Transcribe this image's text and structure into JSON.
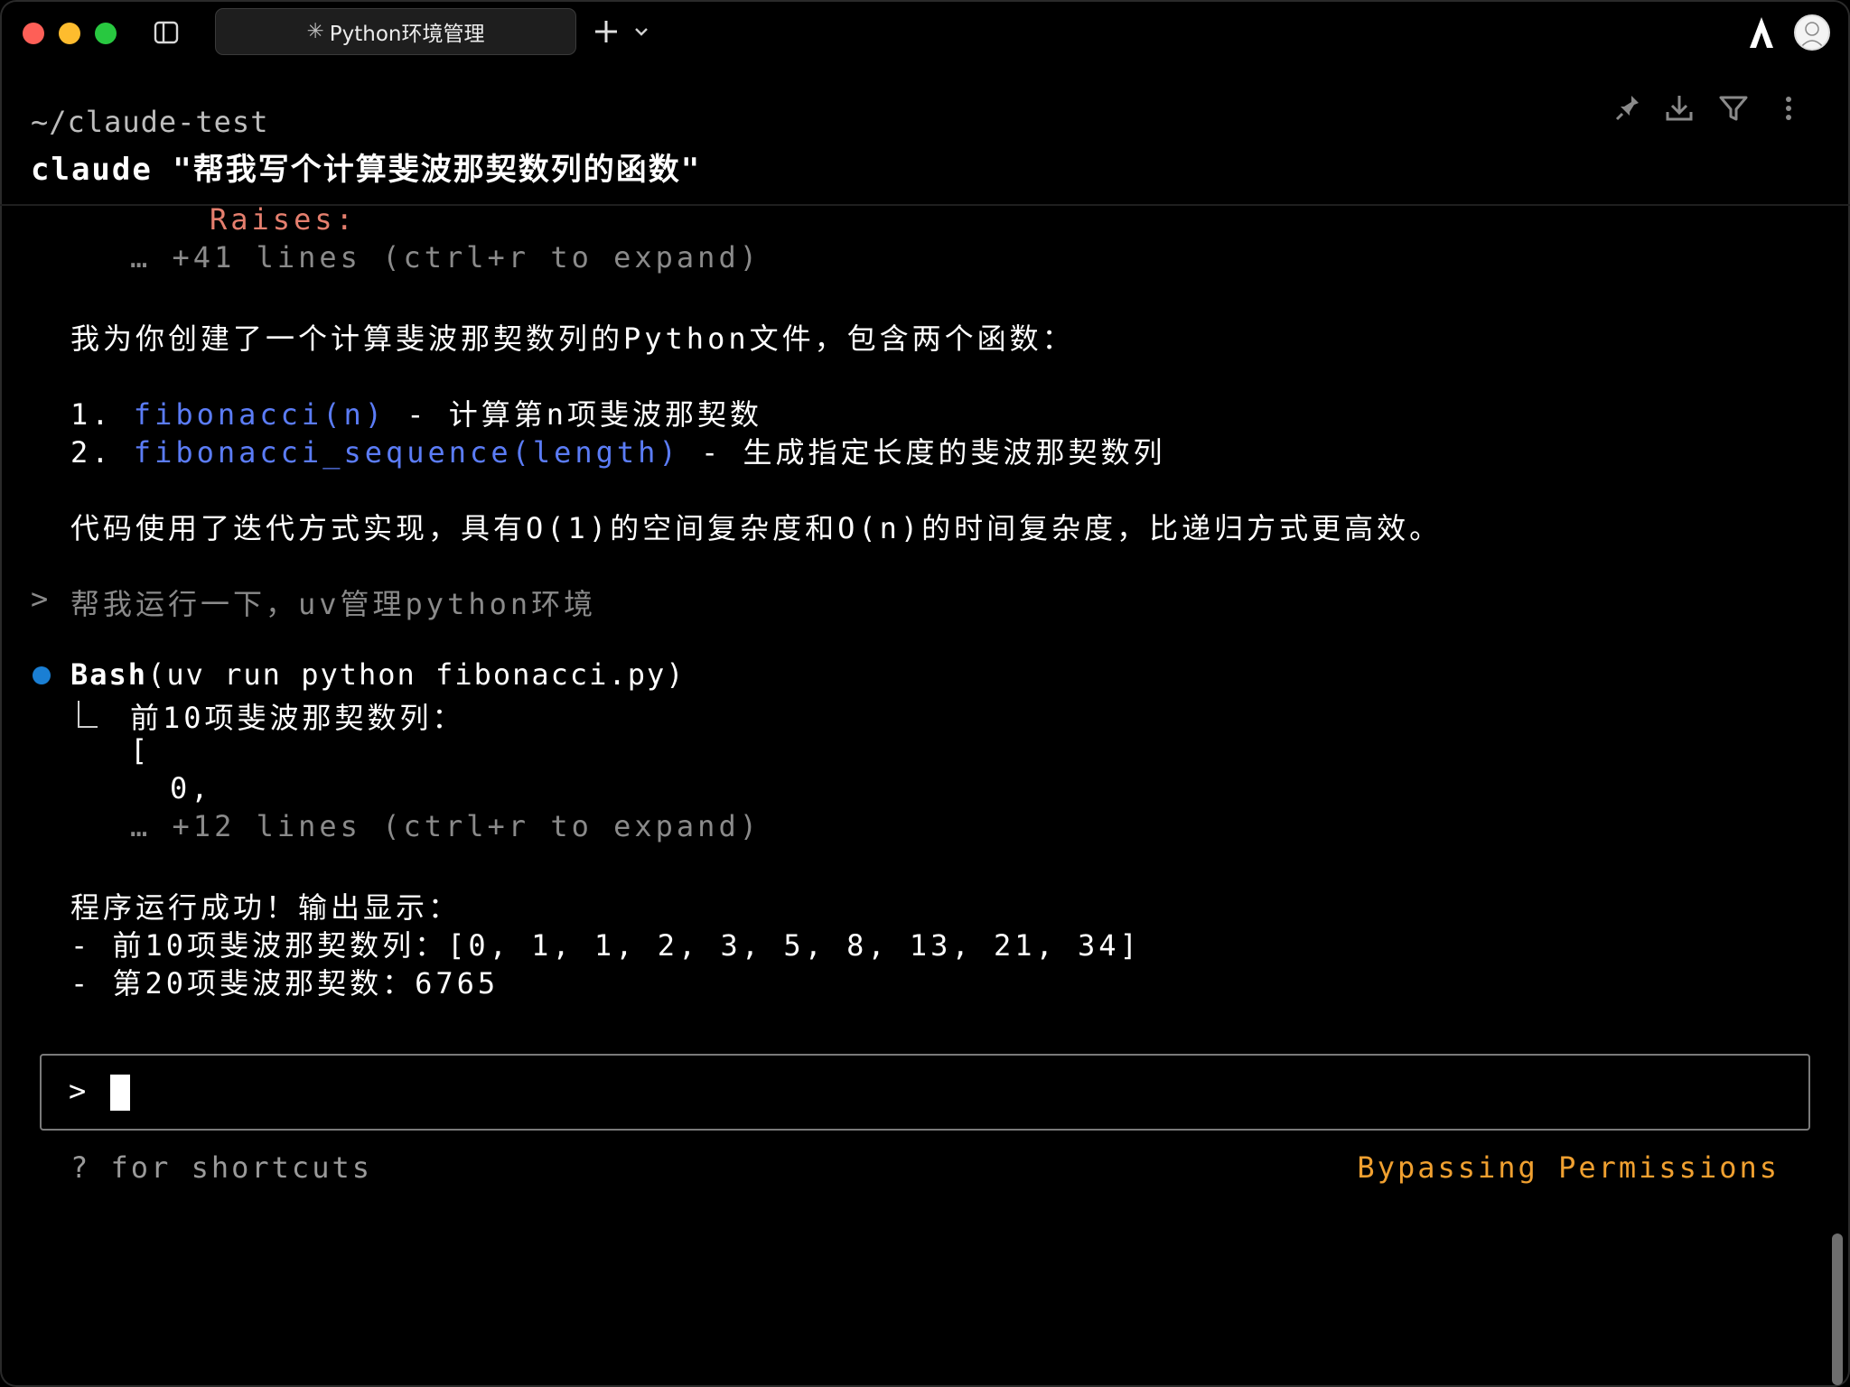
{
  "titlebar": {
    "tab_title": "Python环境管理",
    "tab_prefix_glyph": "✳"
  },
  "header": {
    "path": "~/claude-test",
    "command": "claude \"帮我写个计算斐波那契数列的函数\""
  },
  "transcript": {
    "raises_label": "Raises:",
    "collapsed1": "… +41 lines (ctrl+r to expand)",
    "summary_intro": "我为你创建了一个计算斐波那契数列的Python文件，包含两个函数：",
    "item1_num": "1. ",
    "item1_code": "fibonacci(n)",
    "item1_desc": " - 计算第n项斐波那契数",
    "item2_num": "2. ",
    "item2_code": "fibonacci_sequence(length)",
    "item2_desc": " - 生成指定长度的斐波那契数列",
    "complexity": "代码使用了迭代方式实现，具有O(1)的空间复杂度和O(n)的时间复杂度，比递归方式更高效。",
    "user_prompt_marker": ">",
    "user_prompt": "帮我运行一下，uv管理python环境",
    "tool_name": "Bash",
    "tool_args": "(uv run python fibonacci.py)",
    "out1": "前10项斐波那契数列：",
    "out2": "[",
    "out3": "0,",
    "collapsed2": "… +12 lines (ctrl+r to expand)",
    "result_intro": "程序运行成功！输出显示：",
    "result1": "- 前10项斐波那契数列：[0, 1, 1, 2, 3, 5, 8, 13, 21, 34]",
    "result2": "- 第20项斐波那契数：6765"
  },
  "input": {
    "prompt": ">",
    "value": ""
  },
  "footer": {
    "hint": "? for shortcuts",
    "mode": "Bypassing Permissions"
  },
  "colors": {
    "bullet": "#1a7fd4",
    "code_blue": "#5b7cf6",
    "raises": "#e57f6e",
    "mode": "#f0a030"
  }
}
